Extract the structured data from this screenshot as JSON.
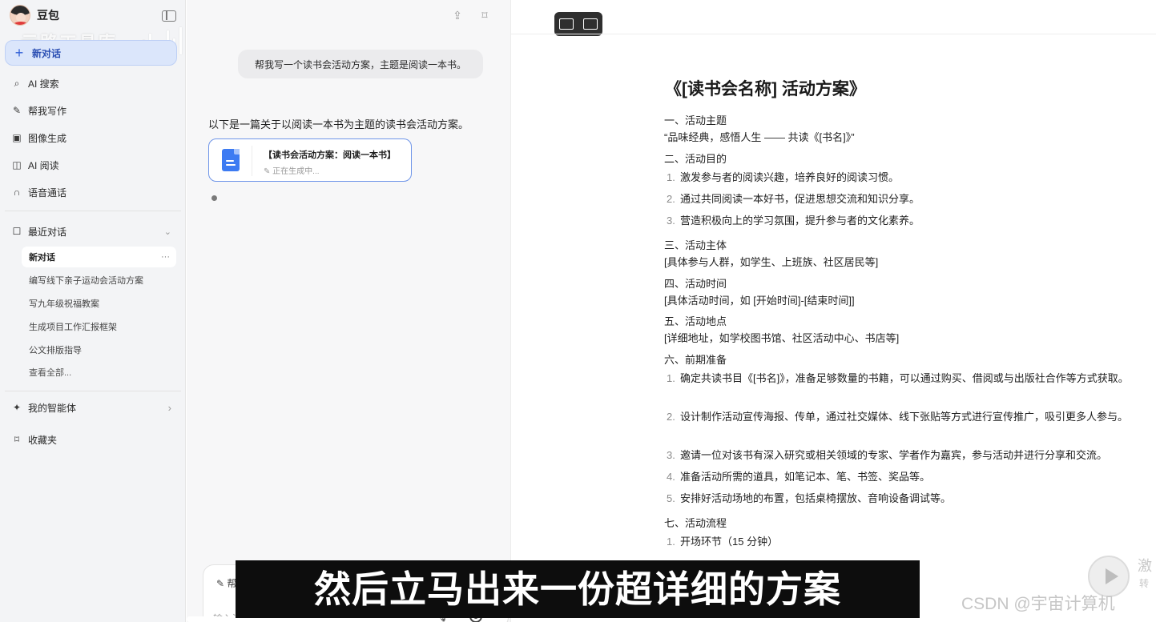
{
  "sidebar": {
    "brand": "豆包",
    "watermark": "云路工具库",
    "new_chat": "新对话",
    "nav": [
      {
        "label": "AI 搜索",
        "icon": "search-icon"
      },
      {
        "label": "帮我写作",
        "icon": "pen-icon"
      },
      {
        "label": "图像生成",
        "icon": "image-icon"
      },
      {
        "label": "AI 阅读",
        "icon": "book-icon"
      },
      {
        "label": "语音通话",
        "icon": "headphone-icon"
      }
    ],
    "recent_title": "最近对话",
    "recent": [
      {
        "label": "新对话",
        "more": "···"
      },
      {
        "label": "编写线下亲子运动会活动方案"
      },
      {
        "label": "写九年级祝福教案"
      },
      {
        "label": "生成项目工作汇报框架"
      },
      {
        "label": "公文排版指导"
      },
      {
        "label": "查看全部..."
      }
    ],
    "agents": "我的智能体",
    "favorites": "收藏夹"
  },
  "chat": {
    "user_message": "帮我写一个读书会活动方案，主题是阅读一本书。",
    "reply_intro": "以下是一篇关于以阅读一本书为主题的读书会活动方案。",
    "doc_card": {
      "title": "【读书会活动方案：阅读一本书】",
      "status": "正在生成中..."
    },
    "input_prefix": "帮",
    "input_placeholder": "输入消息..."
  },
  "doc": {
    "title": "《[读书会名称] 活动方案》",
    "s1_title": "一、活动主题",
    "s1_body": "“品味经典，感悟人生 —— 共读《[书名]》”",
    "s2_title": "二、活动目的",
    "s2_items": [
      "激发参与者的阅读兴趣，培养良好的阅读习惯。",
      "通过共同阅读一本好书，促进思想交流和知识分享。",
      "营造积极向上的学习氛围，提升参与者的文化素养。"
    ],
    "s3_title": "三、活动主体",
    "s3_body": "[具体参与人群，如学生、上班族、社区居民等]",
    "s4_title": "四、活动时间",
    "s4_body": "[具体活动时间，如 [开始时间]-[结束时间]]",
    "s5_title": "五、活动地点",
    "s5_body": "[详细地址，如学校图书馆、社区活动中心、书店等]",
    "s6_title": "六、前期准备",
    "s6_items": [
      "确定共读书目《[书名]》，准备足够数量的书籍，可以通过购买、借阅或与出版社合作等方式获取。",
      "设计制作活动宣传海报、传单，通过社交媒体、线下张贴等方式进行宣传推广，吸引更多人参与。",
      "邀请一位对该书有深入研究或相关领域的专家、学者作为嘉宾，参与活动并进行分享和交流。",
      "准备活动所需的道具，如笔记本、笔、书签、奖品等。",
      "安排好活动场地的布置，包括桌椅摆放、音响设备调试等。"
    ],
    "s7_title": "七、活动流程",
    "s7_items": [
      "开场环节（15 分钟）"
    ]
  },
  "overlay": {
    "subtitle": "然后立马出来一份超详细的方案",
    "csdn": "CSDN @宇宙计算机",
    "side_hint1": "激",
    "side_hint2": "转"
  },
  "icons": {
    "share": "share-icon",
    "bookmark": "bookmark-icon"
  },
  "colors": {
    "accent": "#2f5fd7",
    "doc_card_border": "#6f95e8"
  }
}
